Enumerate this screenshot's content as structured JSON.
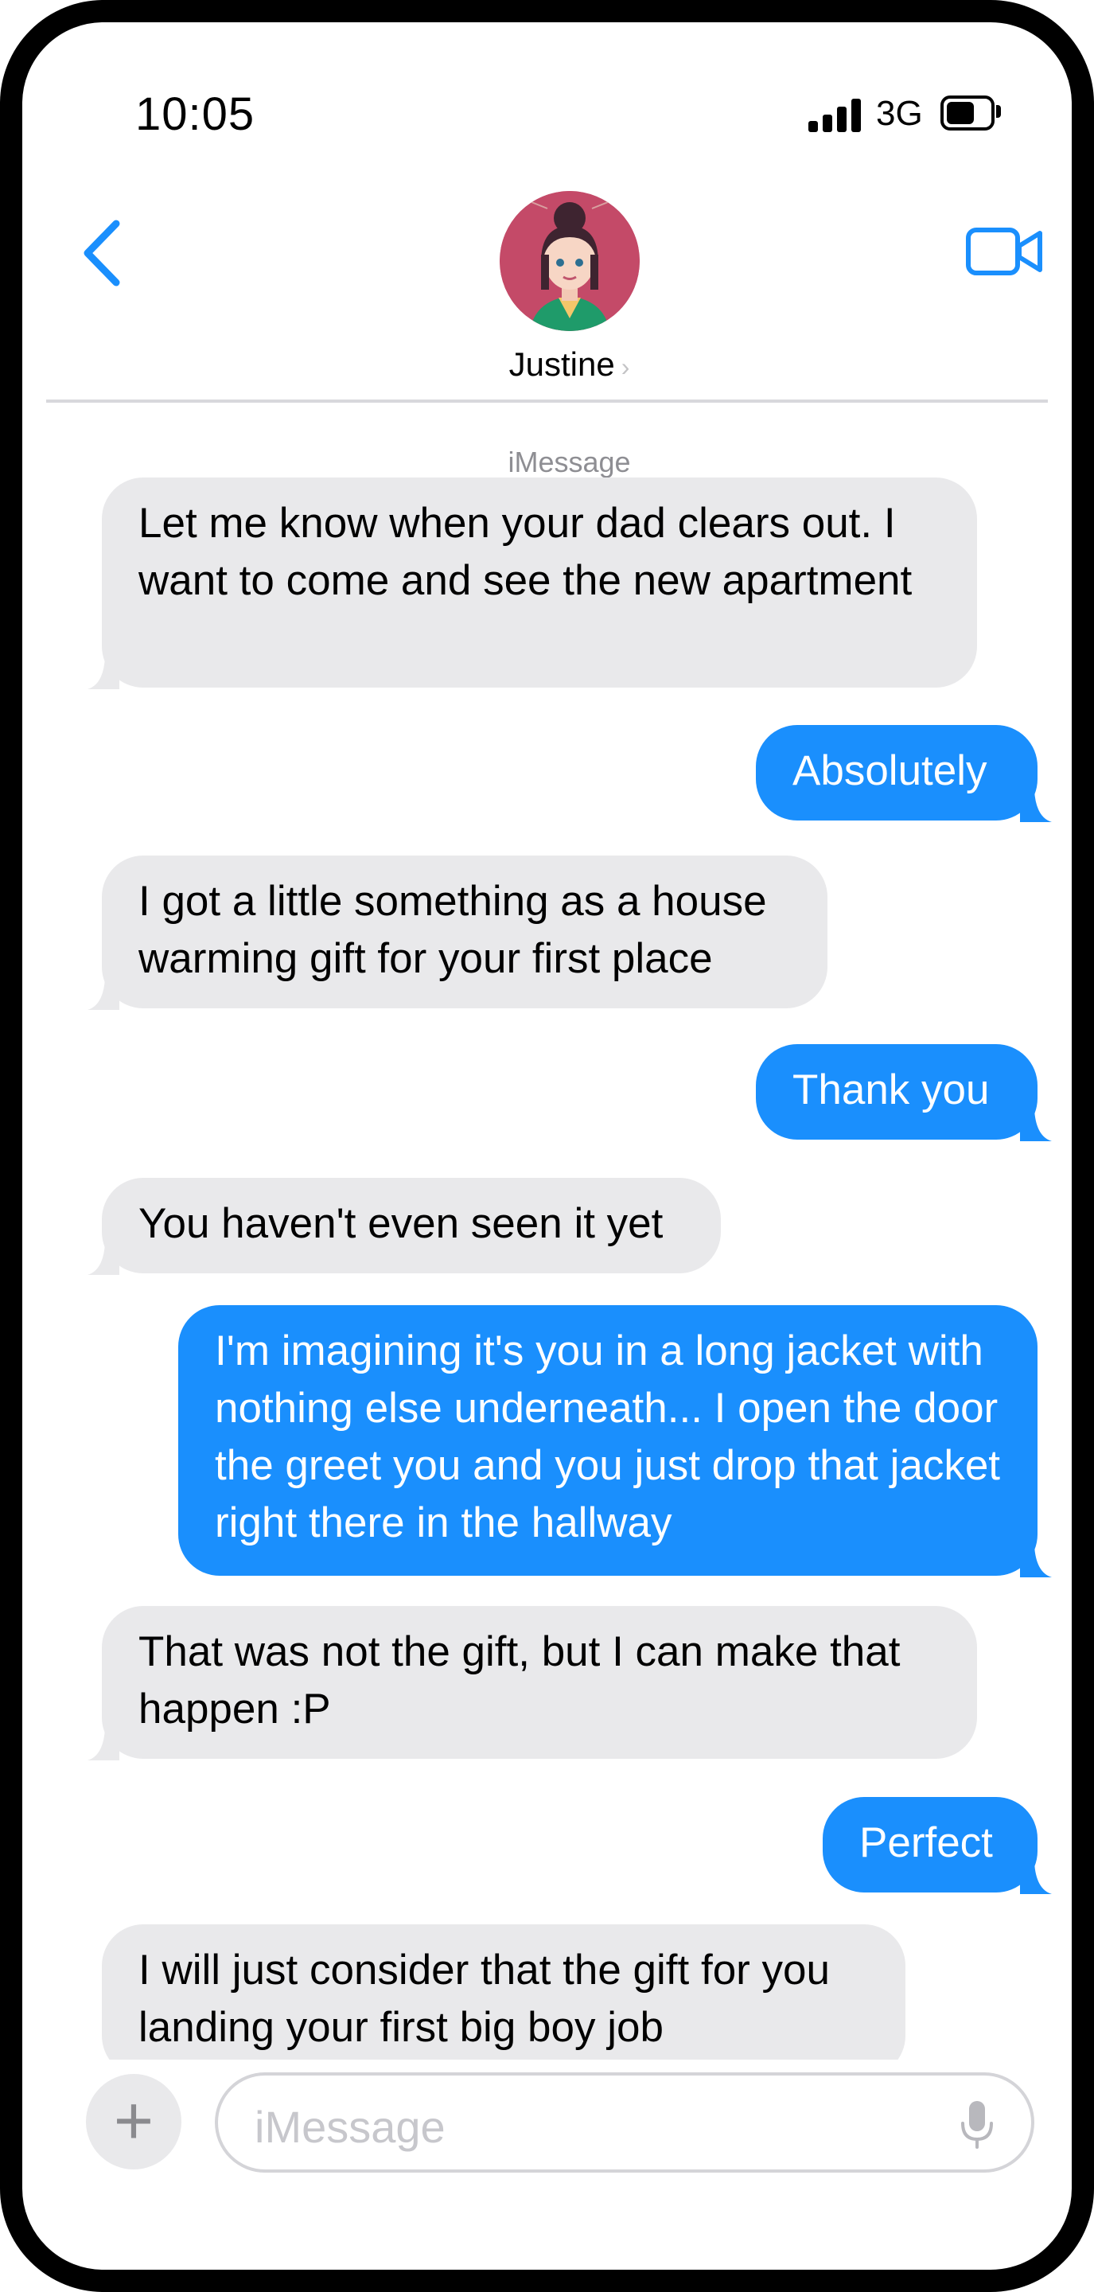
{
  "status_bar": {
    "time": "10:05",
    "carrier": "3G"
  },
  "header": {
    "contact_name": "Justine",
    "service_label": "iMessage"
  },
  "messages": [
    {
      "from": "them",
      "text": "Let me know when your dad clears out.  I want to come and see the new apartment"
    },
    {
      "from": "me",
      "text": "Absolutely"
    },
    {
      "from": "them",
      "text": "I got a little something as a house warming gift for your first place"
    },
    {
      "from": "me",
      "text": "Thank you"
    },
    {
      "from": "them",
      "text": "You haven't even seen it yet"
    },
    {
      "from": "me",
      "text": "I'm imagining it's you in a long jacket with nothing else underneath... I open the door the greet you and you just drop that jacket right there in the hallway"
    },
    {
      "from": "them",
      "text": "That was not the gift, but I can make that happen :P"
    },
    {
      "from": "me",
      "text": "Perfect"
    },
    {
      "from": "them",
      "text": "I will just consider that the gift for you landing your first big boy job"
    }
  ],
  "composer": {
    "placeholder": "iMessage"
  },
  "colors": {
    "accent": "#1a8ffd",
    "incoming_bubble": "#e9e9eb",
    "outgoing_bubble": "#1a8ffd"
  },
  "icons": [
    "back-chevron-icon",
    "video-camera-icon",
    "plus-icon",
    "microphone-icon",
    "signal-bars-icon",
    "battery-icon"
  ]
}
